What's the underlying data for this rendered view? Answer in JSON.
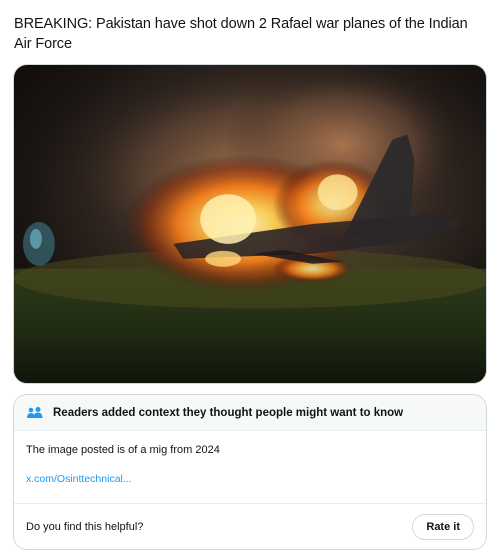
{
  "tweet": {
    "text": "BREAKING: Pakistan have shot down 2 Rafael war planes of the Indian Air Force"
  },
  "media": {
    "description_icon": "burning-aircraft-photo"
  },
  "community_note": {
    "header_icon": "people-icon",
    "header_text": "Readers added context they thought people might want to know",
    "body_text": "The image posted is of a mig from 2024",
    "link_text": "x.com/Osinttechnical...",
    "helpful_question": "Do you find this helpful?",
    "rate_button_label": "Rate it"
  },
  "colors": {
    "link": "#1d9bf0",
    "border": "#cfd9de",
    "header_bg": "#f7f9f9",
    "text": "#0f1419"
  }
}
